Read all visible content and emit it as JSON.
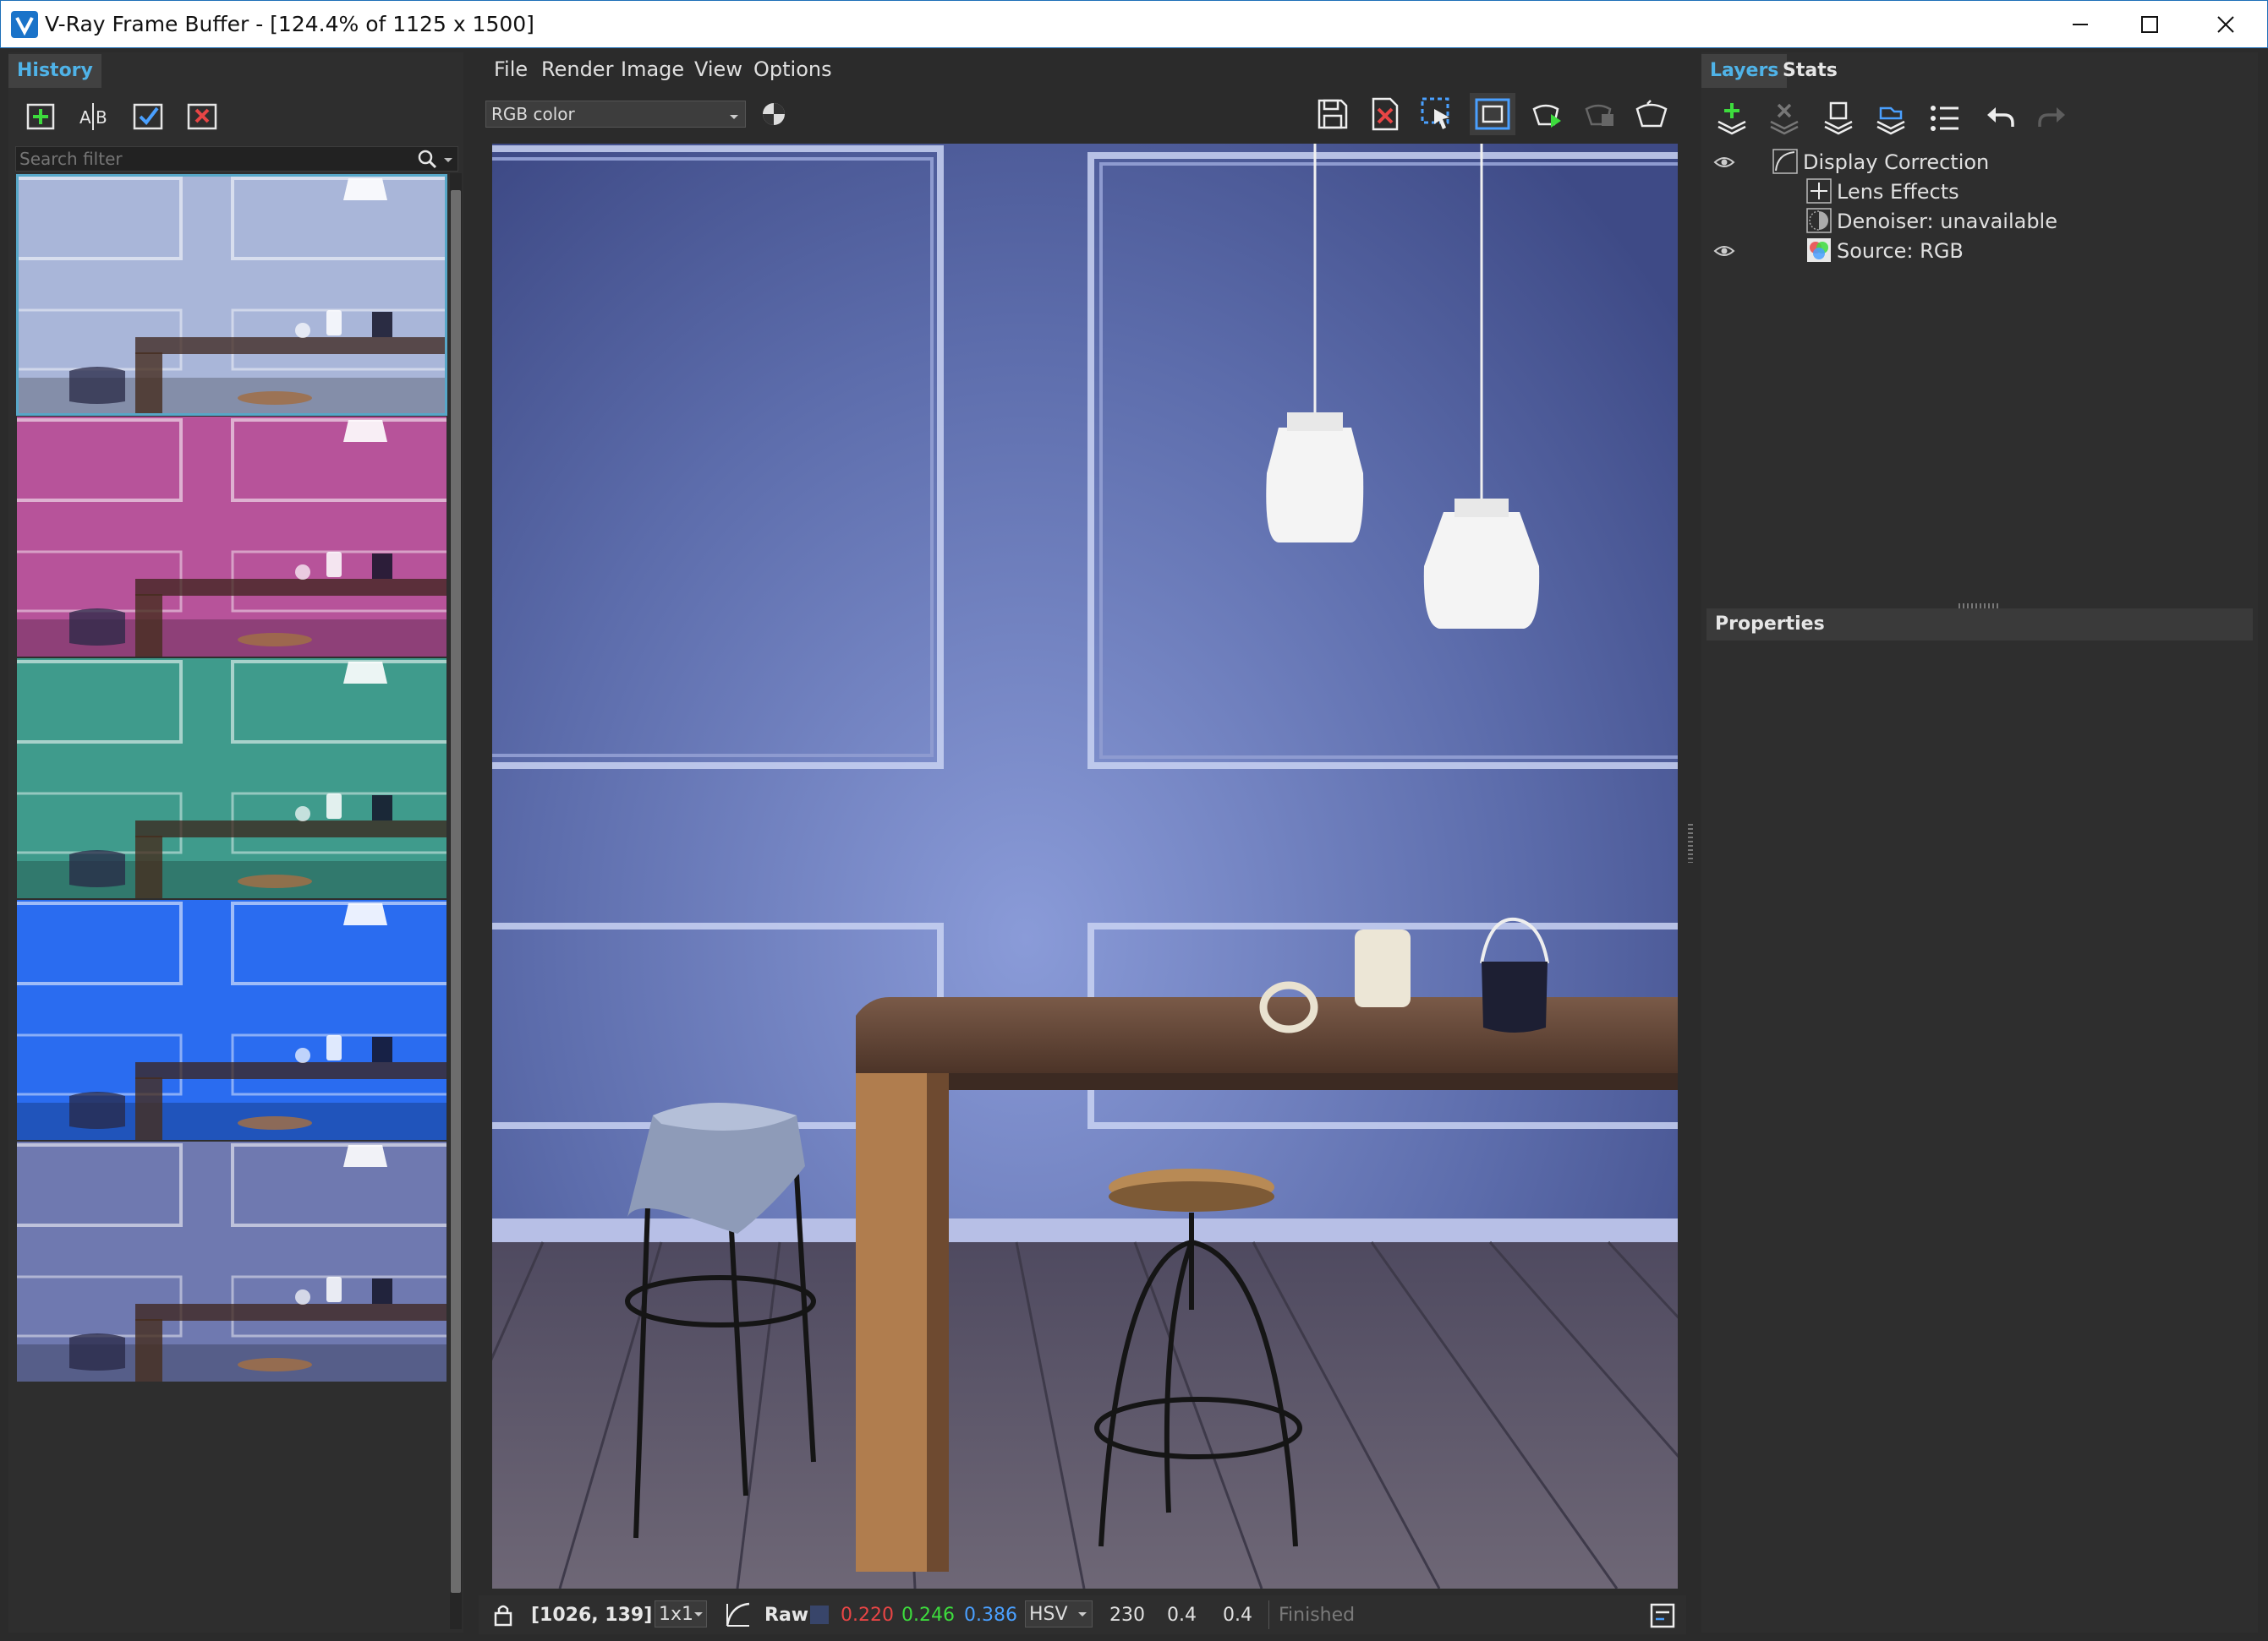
{
  "window": {
    "title": "V-Ray Frame Buffer - [124.4% of 1125 x 1500]"
  },
  "history": {
    "tab_label": "History",
    "search_placeholder": "Search filter",
    "toolbar": [
      "save-to-history-icon",
      "ab-compare-icon",
      "load-image-icon",
      "delete-image-icon"
    ],
    "thumbnails": [
      {
        "tint": "#a9b6d9",
        "selected": true
      },
      {
        "tint": "#b7539a",
        "selected": false
      },
      {
        "tint": "#3f9b8c",
        "selected": false
      },
      {
        "tint": "#2a6cf0",
        "selected": false
      },
      {
        "tint": "#6f79b0",
        "selected": false
      }
    ]
  },
  "menu": {
    "items": [
      "File",
      "Render",
      "Image",
      "View",
      "Options"
    ]
  },
  "view_toolbar": {
    "channel": "RGB color",
    "icons": [
      "save-image-icon",
      "clear-image-icon",
      "region-render-icon",
      "toggle-frame-icon",
      "interactive-render-icon",
      "stop-render-icon",
      "start-render-icon"
    ]
  },
  "statusbar": {
    "coords": "[1026, 139]",
    "zoom": "1x1",
    "mode": "Raw",
    "swatch_color": "#38456a",
    "r": "0.220",
    "g": "0.246",
    "b": "0.386",
    "colorspace": "HSV",
    "h": "230",
    "s": "0.4",
    "v": "0.4",
    "state": "Finished",
    "colors": {
      "r": "#e84545",
      "g": "#3ddc3d",
      "b": "#4aa0ff"
    }
  },
  "layers": {
    "tab_active": "Layers",
    "tab_inactive": "Stats",
    "toolbar": [
      "add-layer-icon",
      "remove-layer-icon",
      "save-layer-tree-icon",
      "load-layer-tree-icon",
      "list-icon",
      "undo-icon",
      "redo-icon"
    ],
    "tree": [
      {
        "label": "Display Correction",
        "visible": true,
        "icon": "curve-icon"
      },
      {
        "label": "Lens Effects",
        "visible": false,
        "icon": "lens-effects-icon"
      },
      {
        "label": "Denoiser: unavailable",
        "visible": false,
        "icon": "denoiser-icon"
      },
      {
        "label": "Source: RGB",
        "visible": true,
        "icon": "rgb-source-icon"
      }
    ],
    "properties_label": "Properties"
  }
}
